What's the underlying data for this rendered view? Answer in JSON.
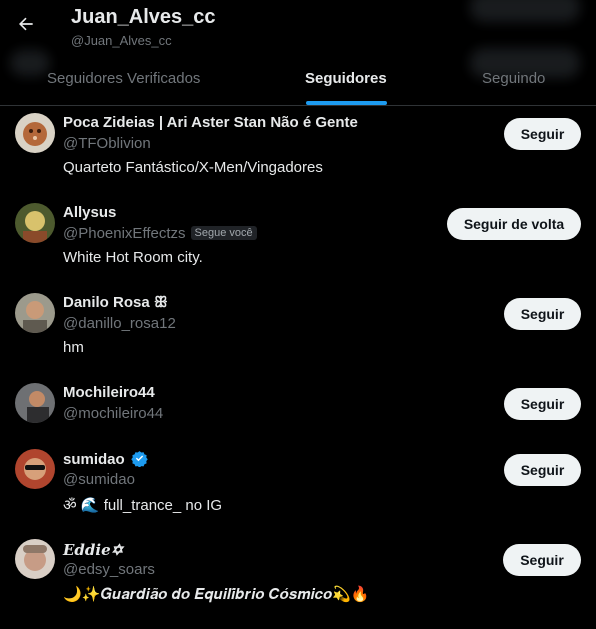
{
  "header": {
    "title": "Juan_Alves_cc",
    "handle": "@Juan_Alves_cc"
  },
  "tabs": [
    {
      "label": "Seguidores Verificados"
    },
    {
      "label": "Seguidores"
    },
    {
      "label": "Seguindo"
    }
  ],
  "active_tab": "Seguidores",
  "users": [
    {
      "name": "Poca Zideias | Ari Aster Stan Não é Gente",
      "handle": "@TFOblivion",
      "bio": "Quarteto Fantástico/X-Men/Vingadores",
      "button": "Seguir"
    },
    {
      "name": "Allysus",
      "handle": "@PhoenixEffectzs",
      "badge": "Segue você",
      "bio": "White Hot Room city.",
      "button": "Seguir de volta"
    },
    {
      "name": "Danilo Rosa ꕥ",
      "handle": "@danillo_rosa12",
      "bio": "hm",
      "button": "Seguir"
    },
    {
      "name": "Mochileiro44",
      "handle": "@mochileiro44",
      "bio": "",
      "button": "Seguir"
    },
    {
      "name": "sumidao",
      "handle": "@sumidao",
      "bio": "ॐ 🌊 full_trance_ no IG",
      "button": "Seguir",
      "verified": true
    },
    {
      "name": "𝑬𝒅𝒅𝒊𝒆✡",
      "handle": "@edsy_soars",
      "bio": "🌙✨𝑮𝒖𝒂𝒓𝒅𝒊𝒂̃𝒐 𝒅𝒐 𝑬𝒒𝒖𝒊𝒍𝒊́𝒃𝒓𝒊𝒐 𝑪𝒐́𝒔𝒎𝒊𝒄𝒐💫🔥",
      "button": "Seguir"
    }
  ],
  "colors": {
    "background": "#000000",
    "primary_text": "#e7e9ea",
    "secondary_text": "#71767b",
    "accent": "#1d9bf0",
    "button_bg": "#eff3f4"
  }
}
